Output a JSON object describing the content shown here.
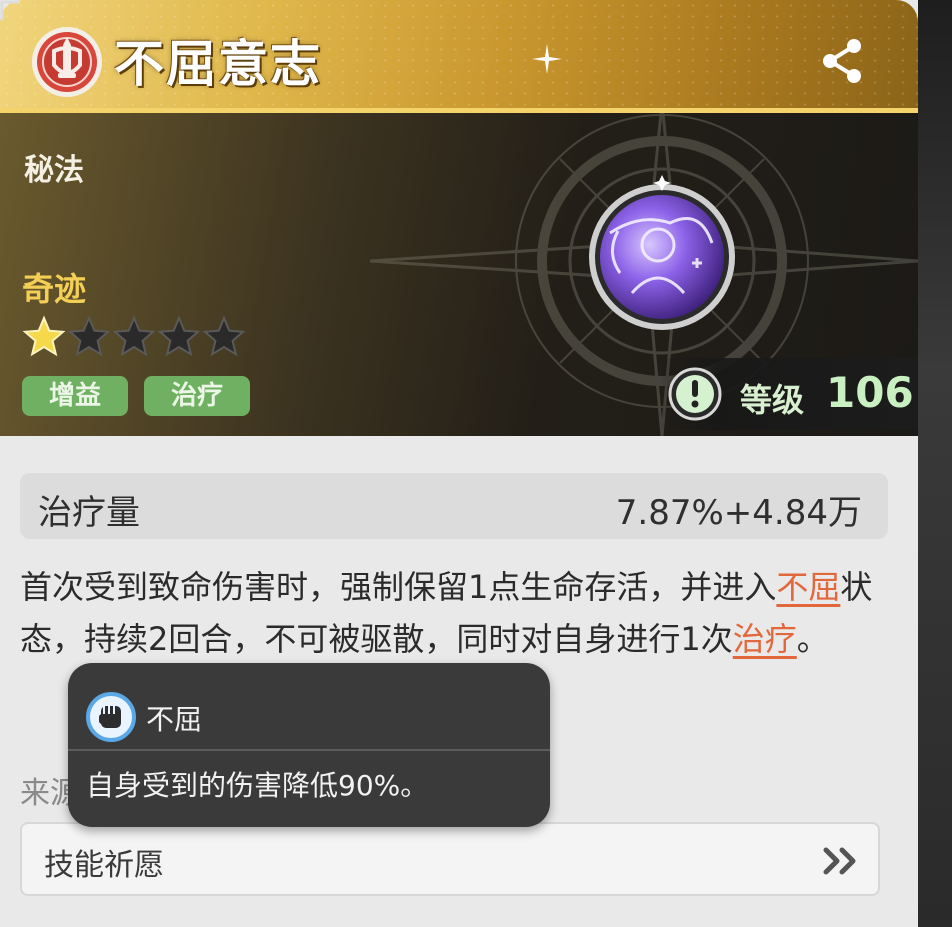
{
  "skill": {
    "title": "不屈意志",
    "category": "秘法",
    "rarity": "奇迹",
    "stars_filled": 1,
    "stars_total": 5,
    "tags": [
      "增益",
      "治疗"
    ],
    "level_label": "等级",
    "level_value": "106"
  },
  "stat": {
    "label": "治疗量",
    "value": "7.87%+4.84万"
  },
  "description": {
    "part1": "首次受到致命伤害时，强制保留1点生命存活，并进入",
    "keyword1": "不屈",
    "part2": "状态，持续2回合，不可被驱散，同时对自身进行1次",
    "keyword2": "治疗",
    "part3": "。"
  },
  "source": {
    "label": "来源",
    "item": "技能祈愿"
  },
  "tooltip": {
    "title": "不屈",
    "body": "自身受到的伤害降低90%。"
  },
  "icons": {
    "badge": "sword-shield-badge-icon",
    "share": "share-icon",
    "warning": "exclamation-icon",
    "tooltip": "fist-icon",
    "chevron": "double-chevron-right-icon"
  },
  "colors": {
    "header_gold": "#e0b84c",
    "rarity_gold": "#f4cf55",
    "tag_green": "#6fb062",
    "keyword_orange": "#e2673c",
    "level_green": "#c9f0c0"
  }
}
